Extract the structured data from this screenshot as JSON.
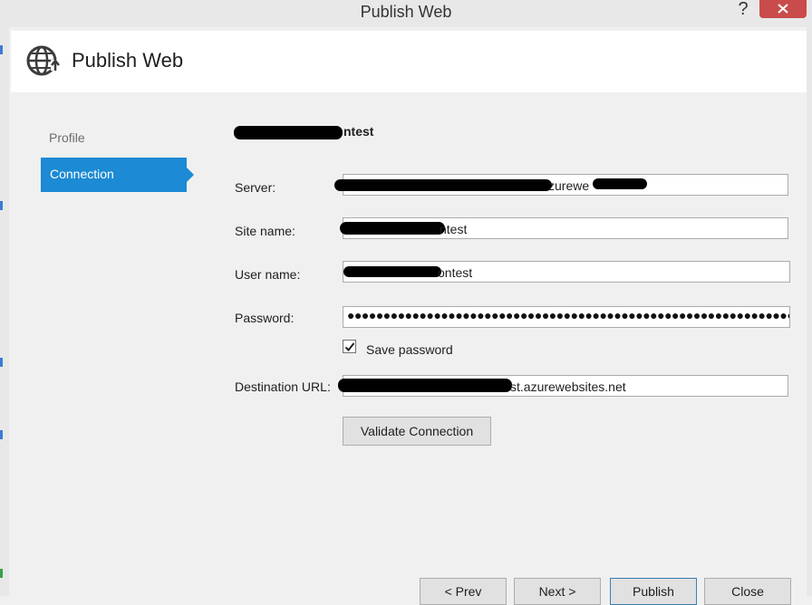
{
  "window": {
    "title": "Publish Web",
    "help_label": "?"
  },
  "header": {
    "title": "Publish Web"
  },
  "nav": {
    "items": [
      {
        "label": "Profile",
        "selected": false
      },
      {
        "label": "Connection",
        "selected": true
      }
    ]
  },
  "profile": {
    "name": "ntest"
  },
  "form": {
    "server": {
      "label": "Server:",
      "value": "zurewe"
    },
    "site_name": {
      "label": "Site name:",
      "value": "ntest"
    },
    "user_name": {
      "label": "User name:",
      "value": "ontest"
    },
    "password": {
      "label": "Password:",
      "value": "●●●●●●●●●●●●●●●●●●●●●●●●●●●●●●●●●●●●●●●●●●●●●●●●●●●●●●●●●●●●●●"
    },
    "save_password": {
      "label": "Save password",
      "checked": true
    },
    "destination_url": {
      "label": "Destination URL:",
      "value": "st.azurewebsites.net"
    },
    "validate_label": "Validate Connection"
  },
  "footer": {
    "prev_label": "< Prev",
    "next_label": "Next >",
    "publish_label": "Publish",
    "close_label": "Close"
  },
  "colors": {
    "accent": "#1c8ad4",
    "window_close": "#c94b4b"
  },
  "icons": {
    "header": "globe-upload-icon",
    "window_close": "close-icon",
    "checkbox": "checkmark-icon"
  }
}
